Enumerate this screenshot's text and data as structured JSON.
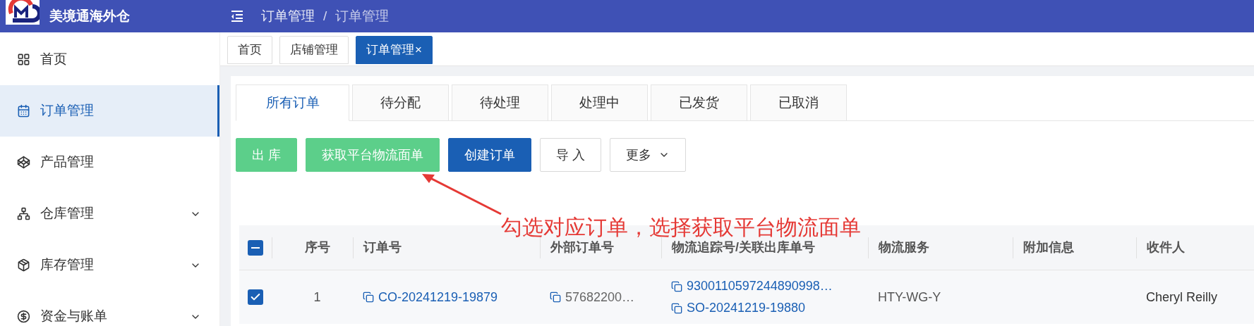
{
  "app": {
    "name": "美境通海外仓"
  },
  "breadcrumb": {
    "items": [
      "订单管理",
      "订单管理"
    ],
    "separator": "/"
  },
  "sidebar": {
    "items": [
      {
        "label": "首页",
        "selected": false,
        "has_submenu": false
      },
      {
        "label": "订单管理",
        "selected": true,
        "has_submenu": false
      },
      {
        "label": "产品管理",
        "selected": false,
        "has_submenu": false
      },
      {
        "label": "仓库管理",
        "selected": false,
        "has_submenu": true
      },
      {
        "label": "库存管理",
        "selected": false,
        "has_submenu": true
      },
      {
        "label": "资金与账单",
        "selected": false,
        "has_submenu": true
      }
    ]
  },
  "page_tabs": [
    {
      "label": "首页",
      "selected": false,
      "closable": false
    },
    {
      "label": "店铺管理",
      "selected": false,
      "closable": false
    },
    {
      "label": "订单管理",
      "selected": true,
      "closable": true,
      "close": "×"
    }
  ],
  "status_tabs": [
    {
      "label": "所有订单",
      "selected": true
    },
    {
      "label": "待分配",
      "selected": false
    },
    {
      "label": "待处理",
      "selected": false
    },
    {
      "label": "处理中",
      "selected": false
    },
    {
      "label": "已发货",
      "selected": false
    },
    {
      "label": "已取消",
      "selected": false
    }
  ],
  "actions": [
    {
      "label": "出 库",
      "kind": "success"
    },
    {
      "label": "获取平台物流面单",
      "kind": "success"
    },
    {
      "label": "创建订单",
      "kind": "primary"
    },
    {
      "label": "导 入",
      "kind": "default"
    },
    {
      "label": "更多",
      "kind": "dropdown"
    }
  ],
  "annotation": {
    "text": "勾选对应订单，选择获取平台物流面单"
  },
  "table": {
    "header_checkbox": {
      "indeterminate": true
    },
    "columns": [
      "序号",
      "订单号",
      "外部订单号",
      "物流追踪号/关联出库单号",
      "物流服务",
      "附加信息",
      "收件人"
    ],
    "rows": [
      {
        "selected": true,
        "index": "1",
        "order_no": "CO-20241219-19879",
        "external_no": "57682200…",
        "tracking": [
          "9300110597244890998…",
          "SO-20241219-19880"
        ],
        "service": "HTY-WG-Y",
        "recipient": "Cheryl Reilly"
      }
    ]
  }
}
